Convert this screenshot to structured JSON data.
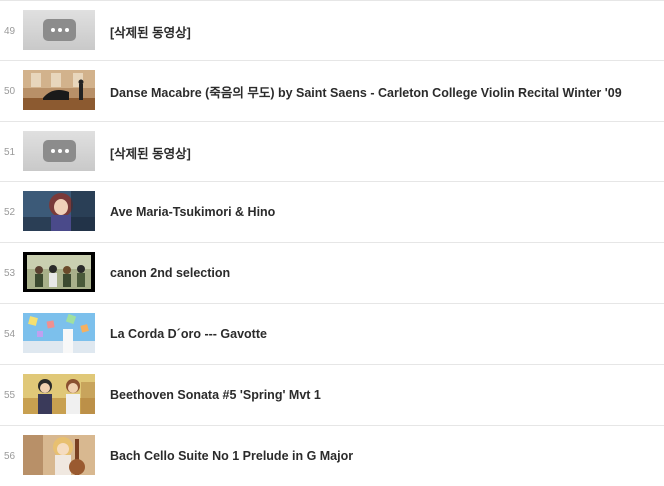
{
  "items": [
    {
      "index": "49",
      "title": "[삭제된 동영상]",
      "thumb": "deleted-placeholder-icon",
      "deleted": true
    },
    {
      "index": "50",
      "title": "Danse Macabre (죽음의 무도) by Saint Saens - Carleton College Violin Recital Winter '09",
      "thumb": "concert-hall-thumbnail"
    },
    {
      "index": "51",
      "title": "[삭제된 동영상]",
      "thumb": "deleted-placeholder-icon",
      "deleted": true
    },
    {
      "index": "52",
      "title": "Ave Maria-Tsukimori & Hino",
      "thumb": "anime-girl-thumbnail"
    },
    {
      "index": "53",
      "title": "canon 2nd selection",
      "thumb": "anime-group-thumbnail"
    },
    {
      "index": "54",
      "title": "La Corda D´oro --- Gavotte",
      "thumb": "anime-sky-thumbnail"
    },
    {
      "index": "55",
      "title": "Beethoven Sonata #5 'Spring' Mvt 1",
      "thumb": "anime-violin-thumbnail"
    },
    {
      "index": "56",
      "title": "Bach Cello Suite No 1 Prelude in G Major",
      "thumb": "anime-cello-thumbnail"
    }
  ],
  "colors": {
    "title": "#2b2b2b",
    "index": "#9a9a9a",
    "divider": "#e6e6e6",
    "placeholder_badge": "#8c8c8c"
  }
}
